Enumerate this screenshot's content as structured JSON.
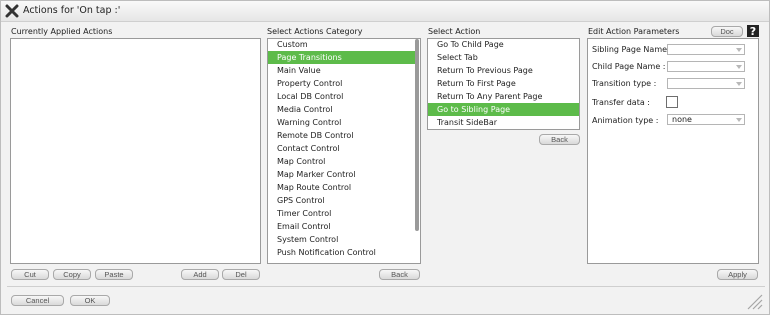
{
  "window": {
    "title": "Actions for 'On tap :'"
  },
  "applied": {
    "label": "Currently Applied Actions",
    "buttons": {
      "cut": "Cut",
      "copy": "Copy",
      "paste": "Paste",
      "add": "Add",
      "del": "Del"
    }
  },
  "categories": {
    "label": "Select Actions Category",
    "selected_index": 1,
    "items": [
      "Custom",
      "Page Transitions",
      "Main Value",
      "Property Control",
      "Local DB Control",
      "Media Control",
      "Warning Control",
      "Remote DB Control",
      "Contact Control",
      "Map Control",
      "Map Marker Control",
      "Map Route Control",
      "GPS Control",
      "Timer Control",
      "Email Control",
      "System Control",
      "Push Notification Control"
    ],
    "back_label": "Back"
  },
  "actions": {
    "label": "Select Action",
    "selected_index": 5,
    "items": [
      "Go To Child Page",
      "Select Tab",
      "Return To Previous Page",
      "Return To First Page",
      "Return To Any Parent Page",
      "Go to Sibling Page",
      "Transit SideBar"
    ],
    "back_label": "Back"
  },
  "params": {
    "label": "Edit Action Parameters",
    "doc_label": "Doc",
    "sibling_page_label": "Sibling Page Name :",
    "sibling_page_value": "",
    "child_page_label": "Child Page Name :",
    "child_page_value": "",
    "transition_label": "Transition type :",
    "transition_value": "",
    "transfer_label": "Transfer data :",
    "animation_label": "Animation type :",
    "animation_value": "none",
    "apply_label": "Apply"
  },
  "footer": {
    "cancel": "Cancel",
    "ok": "OK"
  },
  "colors": {
    "selection": "#5dbb4a",
    "background": "#f2f2f2",
    "border": "#9a9a9a"
  }
}
